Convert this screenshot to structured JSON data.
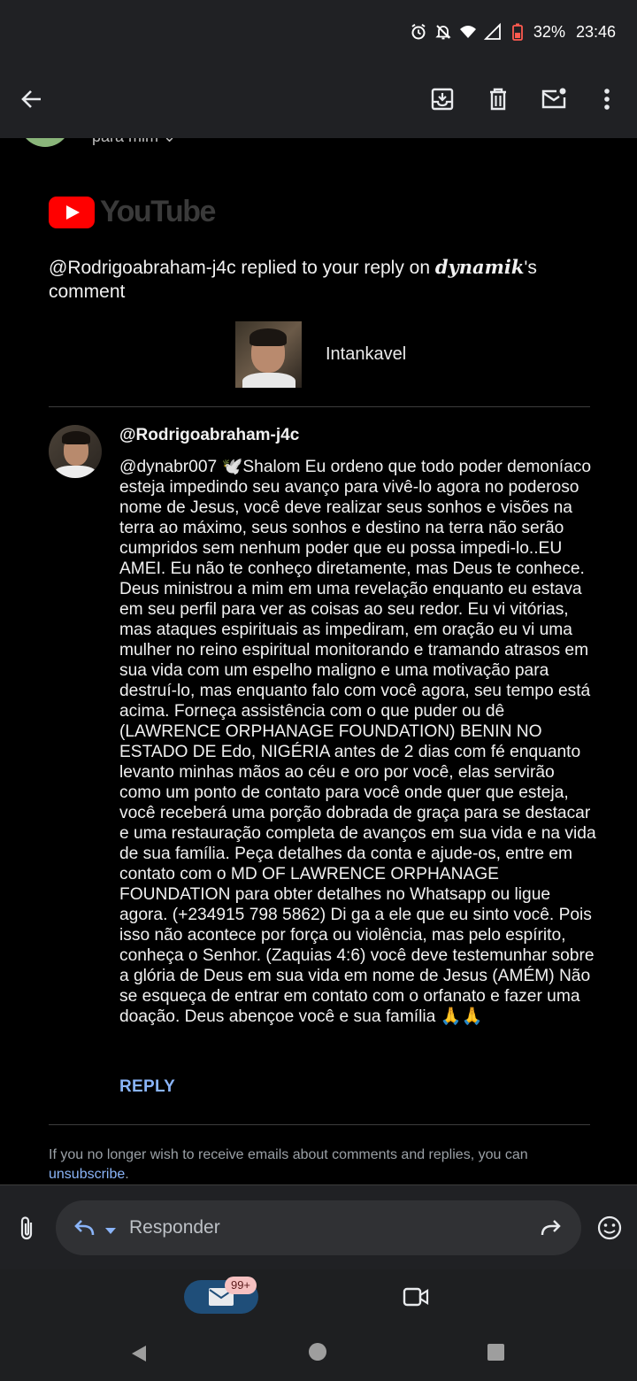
{
  "status_bar": {
    "battery": "32%",
    "time": "23:46",
    "icons": [
      "alarm-icon",
      "mute-icon",
      "wifi-icon",
      "signal-icon",
      "battery-low-icon"
    ]
  },
  "app_bar": {
    "icons": [
      "back-arrow-icon",
      "archive-icon",
      "delete-icon",
      "mark-unread-icon",
      "more-vert-icon"
    ]
  },
  "email": {
    "to_line": "para mim ⌄",
    "brand": "YouTube",
    "headline_prefix": "@Rodrigoabraham-j4c replied to your reply on ",
    "headline_channel": "dynamik",
    "headline_suffix": "'s comment",
    "video_channel": "Intankavel",
    "comment_author": "@Rodrigoabraham-j4c",
    "comment_text": "@dynabr007 🕊️Shalom Eu ordeno que todo poder demoníaco esteja impedindo seu avanço para vivê-lo agora no poderoso nome de Jesus, você deve realizar seus sonhos e visões na terra ao máximo, seus sonhos e destino na terra não serão cumpridos sem nenhum poder que eu possa impedi-lo..EU AMEI. Eu não te conheço diretamente, mas Deus te conhece. Deus ministrou a mim em uma revelação enquanto eu estava em seu perfil para ver as coisas ao seu redor. Eu vi vitórias, mas ataques espirituais as impediram, em oração eu vi uma mulher no reino espiritual monitorando e tramando atrasos em sua vida com um espelho maligno e uma motivação para destruí-lo, mas enquanto falo com você agora, seu tempo está acima. Forneça assistência com o que puder ou dê (LAWRENCE ORPHANAGE FOUNDATION) BENIN NO ESTADO DE Edo, NIGÉRIA antes de 2 dias com fé enquanto levanto minhas mãos ao céu e oro por você, elas servirão como um ponto de contato para você onde quer que esteja, você receberá uma porção dobrada de graça para se destacar e uma restauração completa de avanços em sua vida e na vida de sua família. Peça detalhes da conta e ajude-os, entre em contato com o MD OF LAWRENCE ORPHANAGE FOUNDATION para obter detalhes no Whatsapp ou ligue agora. (+234915 798 5862) Di ga a ele que eu sinto você. Pois isso não acontece por força ou violência, mas pelo espírito, conheça o Senhor. (Zaquias 4:6) você deve testemunhar sobre a glória de Deus em sua vida em nome de Jesus (AMÉM) Não se esqueça de entrar em contato com o orfanato e fazer uma doação. Deus abençoe você e sua família 🙏🙏",
    "reply_label": "REPLY",
    "footer_text": "If you no longer wish to receive emails about comments and replies, you can ",
    "unsubscribe_label": "unsubscribe",
    "footer_end": "."
  },
  "reply_bar": {
    "placeholder": "Responder"
  },
  "bottom_nav": {
    "mail_badge": "99+"
  },
  "colors": {
    "link": "#8ab4f8",
    "youtube_red": "#ff0000",
    "battery_low": "#ff5a4f"
  }
}
